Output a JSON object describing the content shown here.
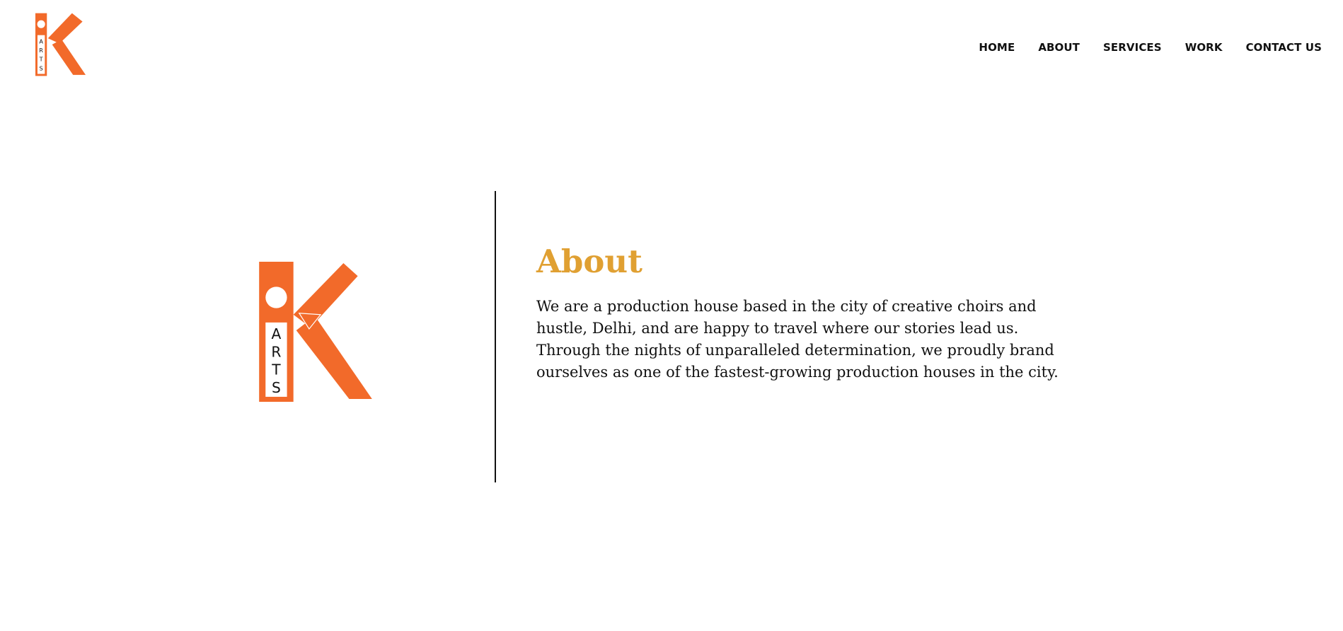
{
  "brand": {
    "logo_letters": [
      "A",
      "R",
      "T",
      "S"
    ],
    "accent_color": "#f26a2a",
    "title_color": "#e0a032"
  },
  "nav": {
    "items": [
      {
        "label": "HOME"
      },
      {
        "label": "ABOUT"
      },
      {
        "label": "SERVICES"
      },
      {
        "label": "WORK"
      },
      {
        "label": "CONTACT US"
      }
    ]
  },
  "about": {
    "title": "About",
    "body": "We are a production house based in the city of creative choirs and hustle, Delhi, and are happy to travel where our stories lead us. Through the nights of unparalleled determination, we proudly brand ourselves as one of the fastest-growing production houses in the city."
  }
}
